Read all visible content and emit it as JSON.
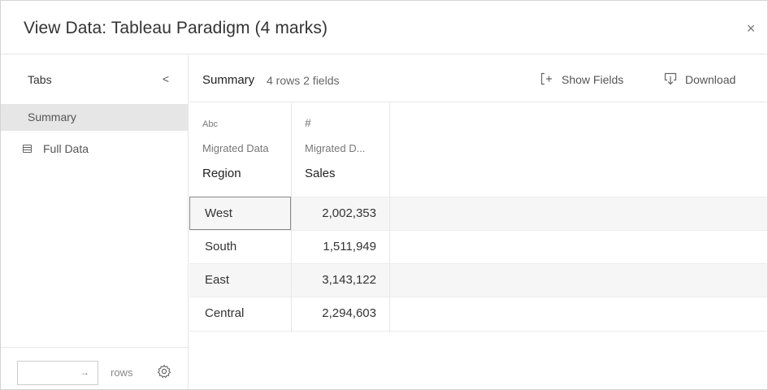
{
  "dialog": {
    "title": "View Data: Tableau Paradigm  (4 marks)",
    "close_glyph": "×"
  },
  "sidebar": {
    "title": "Tabs",
    "collapse_glyph": "<",
    "items": [
      {
        "label": "Summary",
        "active": true
      },
      {
        "label": "Full Data",
        "icon": "table-icon",
        "active": false
      }
    ],
    "footer": {
      "rows_input_value": "",
      "rows_arrow": "→",
      "rows_label": "rows",
      "settings_icon": "gear-icon"
    }
  },
  "toolbar": {
    "title": "Summary",
    "meta": "4 rows 2 fields",
    "show_fields_label": "Show Fields",
    "show_fields_icon": "add-field-icon",
    "download_label": "Download",
    "download_icon": "download-icon"
  },
  "table": {
    "columns": [
      {
        "type_glyph": "Abc",
        "source": "Migrated Data",
        "name": "Region"
      },
      {
        "type_glyph": "#",
        "source": "Migrated D...",
        "name": "Sales"
      }
    ],
    "rows": [
      {
        "region": "West",
        "sales": "2,002,353"
      },
      {
        "region": "South",
        "sales": "1,511,949"
      },
      {
        "region": "East",
        "sales": "3,143,122"
      },
      {
        "region": "Central",
        "sales": "2,294,603"
      }
    ]
  },
  "colors": {
    "selected_sidebar_bg": "#e6e6e6",
    "shaded_row_bg": "#f6f6f6",
    "border": "#e6e6e6"
  }
}
